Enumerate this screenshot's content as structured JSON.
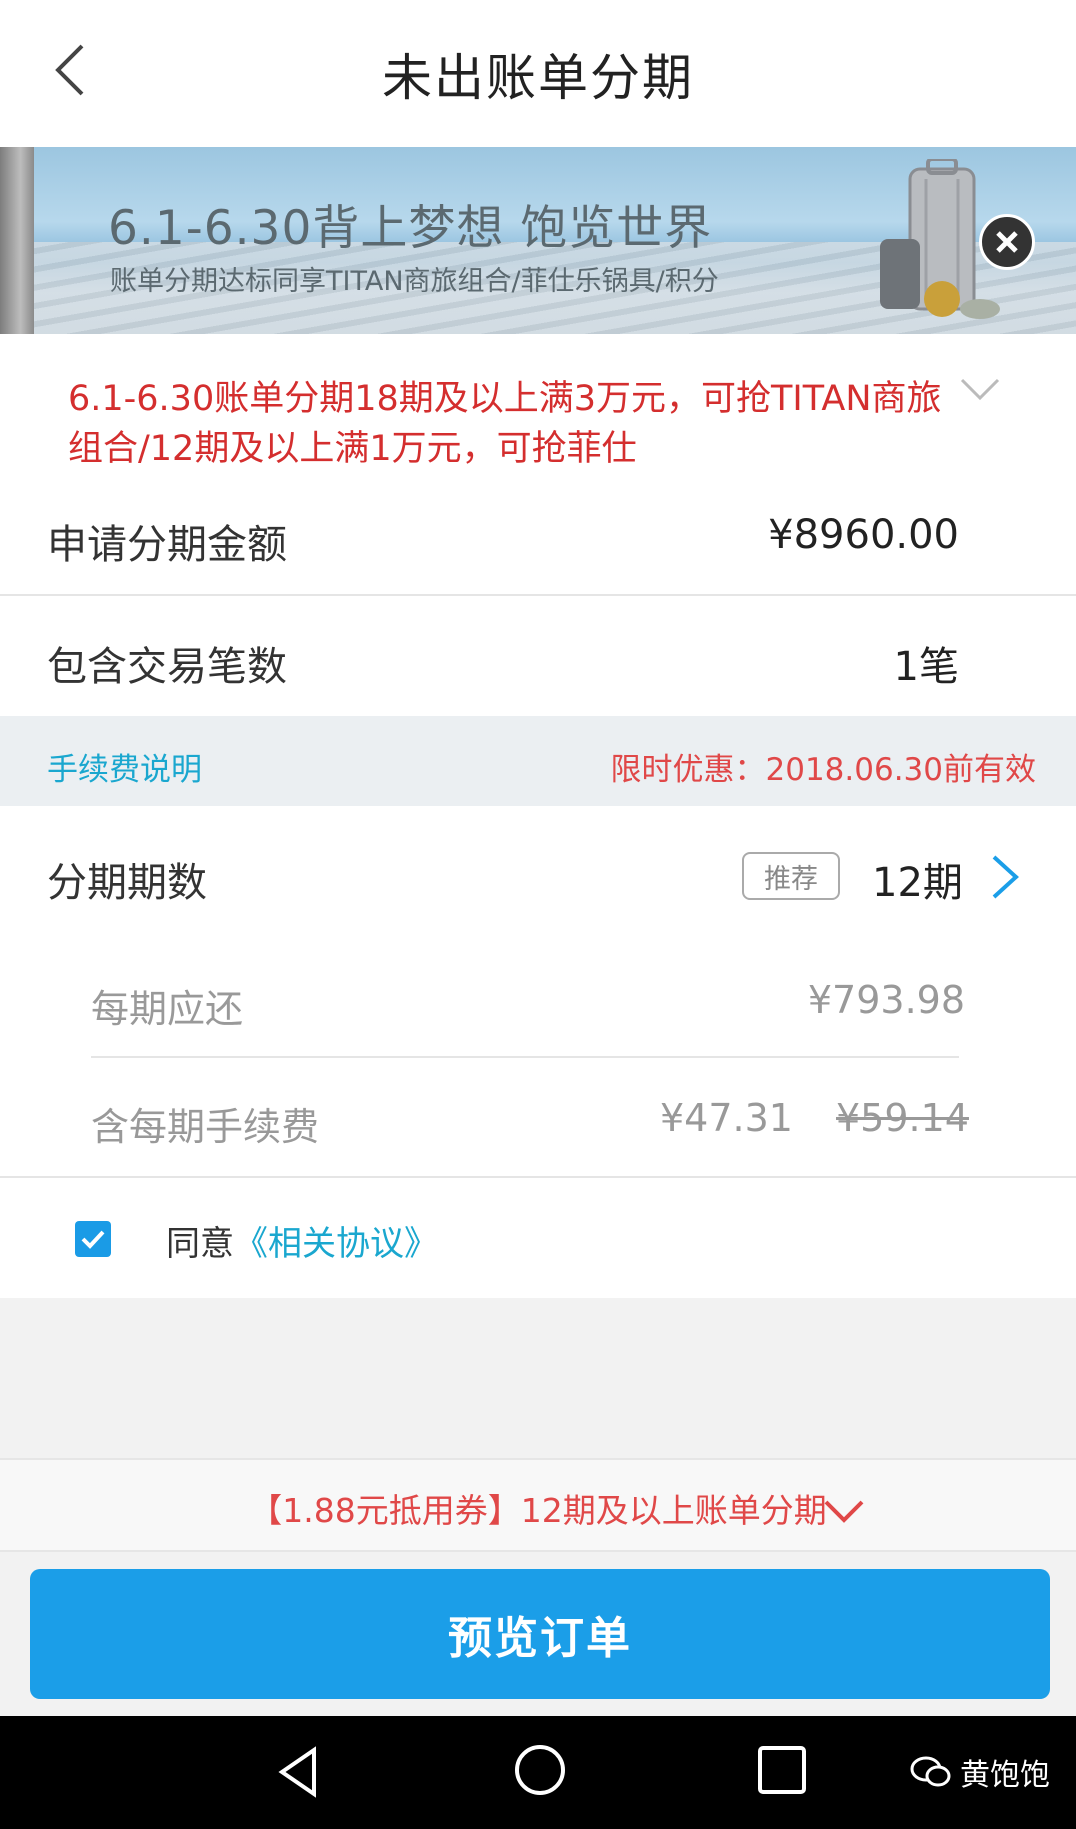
{
  "header": {
    "title": "未出账单分期"
  },
  "banner": {
    "headline": "6.1-6.30背上梦想 饱览世界",
    "subline": "账单分期达标同享TITAN商旅组合/菲仕乐锅具/积分"
  },
  "promo": {
    "text": "6.1-6.30账单分期18期及以上满3万元，可抢TITAN商旅组合/12期及以上满1万元，可抢菲仕"
  },
  "amount": {
    "label": "申请分期金额",
    "value": "¥8960.00"
  },
  "count": {
    "label": "包含交易笔数",
    "value": "1笔"
  },
  "fee_bar": {
    "link": "手续费说明",
    "offer": "限时优惠：2018.06.30前有效"
  },
  "period": {
    "label": "分期期数",
    "tag": "推荐",
    "value": "12期"
  },
  "detail": {
    "monthly_label": "每期应还",
    "monthly_value": "¥793.98",
    "fee_label": "含每期手续费",
    "fee_value": "¥47.31",
    "fee_original": "¥59.14"
  },
  "agreement": {
    "prefix": "同意",
    "link": "《相关协议》",
    "checked": true
  },
  "coupon": {
    "text": "【1.88元抵用券】12期及以上账单分期"
  },
  "submit": {
    "label": "预览订单"
  },
  "watermark": {
    "text": "黄饱饱"
  },
  "colors": {
    "accent": "#1b9ee8",
    "promo_red": "#d42e2e",
    "link_blue": "#1aa7cf"
  }
}
